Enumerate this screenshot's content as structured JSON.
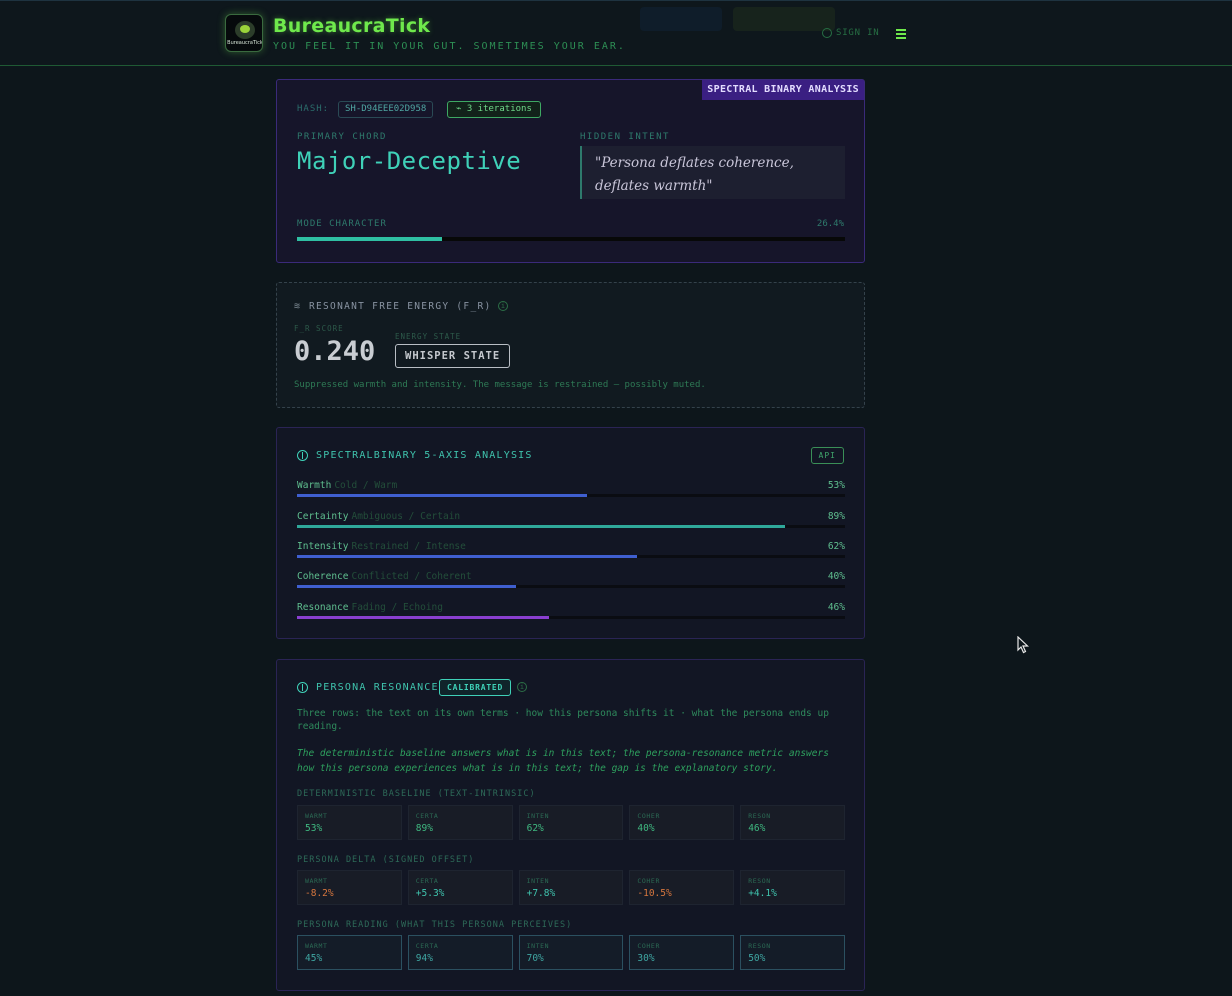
{
  "header": {
    "logo_text": "BureaucraTick",
    "brand": "BureaucraTick",
    "tagline": "YOU FEEL IT IN YOUR GUT. SOMETIMES YOUR EAR.",
    "sign_in": "SIGN IN"
  },
  "spectral": {
    "badge": "SPECTRAL BINARY ANALYSIS",
    "hash_label": "HASH:",
    "hash": "SH-D94EEE02D958",
    "iterations": "3 iterations",
    "primary_label": "PRIMARY CHORD",
    "primary_chord": "Major-Deceptive",
    "hidden_label": "HIDDEN INTENT",
    "hidden_intent": "\"Persona deflates coherence, deflates warmth\"",
    "mode_label": "MODE CHARACTER",
    "mode_value": "26.4%",
    "mode_fraction": 0.264
  },
  "free_energy": {
    "title": "RESONANT FREE ENERGY (F_R)",
    "score_label": "F_R SCORE",
    "score": "0.240",
    "state_label": "ENERGY STATE",
    "state": "WHISPER STATE",
    "description": "Suppressed warmth and intensity. The message is restrained — possibly muted."
  },
  "axes": {
    "title": "SPECTRALBINARY 5-AXIS ANALYSIS",
    "api_badge": "API",
    "items": [
      {
        "name": "Warmth",
        "range": "Cold / Warm",
        "value": "53%",
        "fraction": 0.53,
        "color": "#3f5fd0"
      },
      {
        "name": "Certainty",
        "range": "Ambiguous / Certain",
        "value": "89%",
        "fraction": 0.89,
        "color": "#2fa89a"
      },
      {
        "name": "Intensity",
        "range": "Restrained / Intense",
        "value": "62%",
        "fraction": 0.62,
        "color": "#3f5fd0"
      },
      {
        "name": "Coherence",
        "range": "Conflicted / Coherent",
        "value": "40%",
        "fraction": 0.4,
        "color": "#3f5fd0"
      },
      {
        "name": "Resonance",
        "range": "Fading / Echoing",
        "value": "46%",
        "fraction": 0.46,
        "color": "#8a3fd0"
      }
    ]
  },
  "persona": {
    "title": "PERSONA RESONANCE",
    "badge": "CALIBRATED",
    "desc1": "Three rows: the text on its own terms · how this persona shifts it · what the persona ends up reading.",
    "desc2": "The deterministic baseline answers what is in this text; the persona-resonance metric answers how this persona experiences what is in this text; the gap is the explanatory story.",
    "baseline_label": "DETERMINISTIC BASELINE (TEXT-INTRINSIC)",
    "baseline": [
      {
        "k": "WARMT",
        "v": "53%"
      },
      {
        "k": "CERTA",
        "v": "89%"
      },
      {
        "k": "INTEN",
        "v": "62%"
      },
      {
        "k": "COHER",
        "v": "40%"
      },
      {
        "k": "RESON",
        "v": "46%"
      }
    ],
    "delta_label": "PERSONA DELTA (SIGNED OFFSET)",
    "delta": [
      {
        "k": "WARMT",
        "v": "-8.2%"
      },
      {
        "k": "CERTA",
        "v": "+5.3%"
      },
      {
        "k": "INTEN",
        "v": "+7.8%"
      },
      {
        "k": "COHER",
        "v": "-10.5%"
      },
      {
        "k": "RESON",
        "v": "+4.1%"
      }
    ],
    "reading_label": "PERSONA READING (WHAT THIS PERSONA PERCEIVES)",
    "reading": [
      {
        "k": "WARMT",
        "v": "45%"
      },
      {
        "k": "CERTA",
        "v": "94%"
      },
      {
        "k": "INTEN",
        "v": "70%"
      },
      {
        "k": "COHER",
        "v": "30%"
      },
      {
        "k": "RESON",
        "v": "50%"
      }
    ]
  }
}
